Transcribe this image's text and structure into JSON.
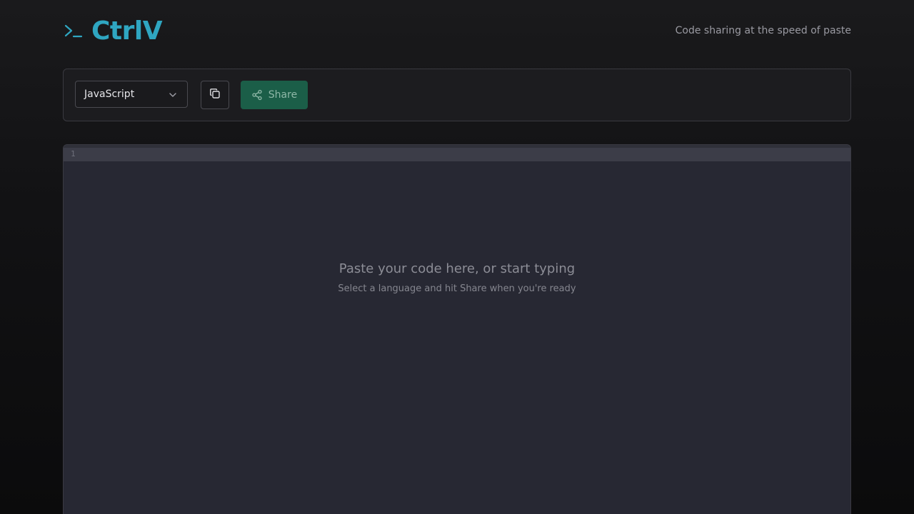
{
  "app": {
    "name": "CtrlV",
    "tagline": "Code sharing at the speed of paste",
    "brand_color": "#2fa6c1"
  },
  "toolbar": {
    "language": {
      "selected": "JavaScript"
    },
    "copy_icon": "copy-icon",
    "share_label": "Share",
    "share_icon": "share-icon",
    "share_color": "#1b5e48"
  },
  "editor": {
    "line_number": "1",
    "placeholder_title": "Paste your code here, or start typing",
    "placeholder_subtitle": "Select a language and hit Share when you're ready"
  }
}
